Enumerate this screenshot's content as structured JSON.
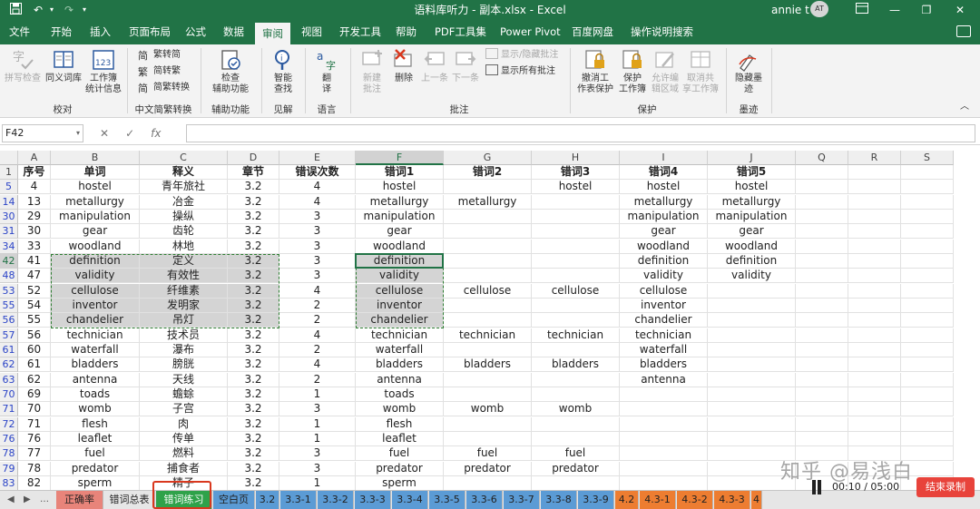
{
  "titlebar": {
    "title": "语料库听力 - 副本.xlsx  -  Excel",
    "user": "annie t",
    "avatar": "AT"
  },
  "ribbon_tabs": [
    "文件",
    "开始",
    "插入",
    "页面布局",
    "公式",
    "数据",
    "审阅",
    "视图",
    "开发工具",
    "帮助",
    "PDF工具集",
    "Power Pivot",
    "百度网盘"
  ],
  "active_tab": "审阅",
  "tell_me": "操作说明搜索",
  "ribbon": {
    "proof": {
      "spell": "拼写检查",
      "thesaurus": "同义词库",
      "stats_1": "工作簿",
      "stats_2": "统计信息",
      "group": "校对"
    },
    "chinese": {
      "to_trad": "繁转简",
      "to_simp": "简转繁",
      "convert": "简繁转换",
      "group": "中文简繁转换"
    },
    "access": {
      "check_1": "检查",
      "check_2": "辅助功能",
      "group": "辅助功能"
    },
    "insights": {
      "smart_1": "智能",
      "smart_2": "查找",
      "group": "见解"
    },
    "language": {
      "translate_1": "翻",
      "translate_2": "译",
      "group": "语言"
    },
    "comments": {
      "new_1": "新建",
      "new_2": "批注",
      "delete": "删除",
      "prev": "上一条",
      "next": "下一条",
      "show_hide": "显示/隐藏批注",
      "show_all": "显示所有批注",
      "group": "批注"
    },
    "protect": {
      "unprotect_1": "撤消工",
      "unprotect_2": "作表保护",
      "protect_wb_1": "保护",
      "protect_wb_2": "工作簿",
      "allow_1": "允许编",
      "allow_2": "辑区域",
      "unshare_1": "取消共",
      "unshare_2": "享工作簿",
      "group": "保护"
    },
    "ink": {
      "hide_1": "隐藏墨",
      "hide_2": "迹",
      "group": "墨迹"
    }
  },
  "formula_bar": {
    "name_box": "F42",
    "fx": "fx"
  },
  "columns": [
    "A",
    "B",
    "C",
    "D",
    "E",
    "F",
    "G",
    "H",
    "I",
    "J",
    "Q",
    "R",
    "S"
  ],
  "header_row": {
    "row_num": "1",
    "cells": [
      "序号",
      "单词",
      "释义",
      "章节",
      "错误次数",
      "错词1",
      "错词2",
      "错词3",
      "错词4",
      "错词5"
    ]
  },
  "rows": [
    {
      "n": "5",
      "cells": [
        "4",
        "hostel",
        "青年旅社",
        "3.2",
        "4",
        "hostel",
        "",
        "hostel",
        "hostel",
        "hostel"
      ]
    },
    {
      "n": "14",
      "cells": [
        "13",
        "metallurgy",
        "冶金",
        "3.2",
        "4",
        "metallurgy",
        "metallurgy",
        "",
        "metallurgy",
        "metallurgy"
      ]
    },
    {
      "n": "30",
      "cells": [
        "29",
        "manipulation",
        "操纵",
        "3.2",
        "3",
        "manipulation",
        "",
        "",
        "manipulation",
        "manipulation"
      ]
    },
    {
      "n": "31",
      "cells": [
        "30",
        "gear",
        "齿轮",
        "3.2",
        "3",
        "gear",
        "",
        "",
        "gear",
        "gear"
      ]
    },
    {
      "n": "34",
      "cells": [
        "33",
        "woodland",
        "林地",
        "3.2",
        "3",
        "woodland",
        "",
        "",
        "woodland",
        "woodland"
      ]
    },
    {
      "n": "42",
      "cells": [
        "41",
        "definition",
        "定义",
        "3.2",
        "3",
        "definition",
        "",
        "",
        "definition",
        "definition"
      ]
    },
    {
      "n": "48",
      "cells": [
        "47",
        "validity",
        "有效性",
        "3.2",
        "3",
        "validity",
        "",
        "",
        "validity",
        "validity"
      ]
    },
    {
      "n": "53",
      "cells": [
        "52",
        "cellulose",
        "纤维素",
        "3.2",
        "4",
        "cellulose",
        "cellulose",
        "cellulose",
        "cellulose",
        ""
      ]
    },
    {
      "n": "55",
      "cells": [
        "54",
        "inventor",
        "发明家",
        "3.2",
        "2",
        "inventor",
        "",
        "",
        "inventor",
        ""
      ]
    },
    {
      "n": "56",
      "cells": [
        "55",
        "chandelier",
        "吊灯",
        "3.2",
        "2",
        "chandelier",
        "",
        "",
        "chandelier",
        ""
      ]
    },
    {
      "n": "57",
      "cells": [
        "56",
        "technician",
        "技术员",
        "3.2",
        "4",
        "technician",
        "technician",
        "technician",
        "technician",
        ""
      ]
    },
    {
      "n": "61",
      "cells": [
        "60",
        "waterfall",
        "瀑布",
        "3.2",
        "2",
        "waterfall",
        "",
        "",
        "waterfall",
        ""
      ]
    },
    {
      "n": "62",
      "cells": [
        "61",
        "bladders",
        "膀胱",
        "3.2",
        "4",
        "bladders",
        "bladders",
        "bladders",
        "bladders",
        ""
      ]
    },
    {
      "n": "63",
      "cells": [
        "62",
        "antenna",
        "天线",
        "3.2",
        "2",
        "antenna",
        "",
        "",
        "antenna",
        ""
      ]
    },
    {
      "n": "70",
      "cells": [
        "69",
        "toads",
        "蟾蜍",
        "3.2",
        "1",
        "toads",
        "",
        "",
        "",
        ""
      ]
    },
    {
      "n": "71",
      "cells": [
        "70",
        "womb",
        "子宫",
        "3.2",
        "3",
        "womb",
        "womb",
        "womb",
        "",
        ""
      ]
    },
    {
      "n": "72",
      "cells": [
        "71",
        "flesh",
        "肉",
        "3.2",
        "1",
        "flesh",
        "",
        "",
        "",
        ""
      ]
    },
    {
      "n": "76",
      "cells": [
        "76",
        "leaflet",
        "传单",
        "3.2",
        "1",
        "leaflet",
        "",
        "",
        "",
        ""
      ]
    },
    {
      "n": "78",
      "cells": [
        "77",
        "fuel",
        "燃料",
        "3.2",
        "3",
        "fuel",
        "fuel",
        "fuel",
        "",
        ""
      ]
    },
    {
      "n": "79",
      "cells": [
        "78",
        "predator",
        "捕食者",
        "3.2",
        "3",
        "predator",
        "predator",
        "predator",
        "",
        ""
      ]
    },
    {
      "n": "83",
      "cells": [
        "82",
        "sperm",
        "精子",
        "3.2",
        "1",
        "sperm",
        "",
        "",
        "",
        ""
      ]
    }
  ],
  "sheet_tabs": [
    {
      "label": "正确率",
      "color": "#e8847a"
    },
    {
      "label": "错词总表",
      "color": "#e6e6e6"
    },
    {
      "label": "错词练习",
      "color": "#2fa24a"
    },
    {
      "label": "空白页",
      "color": "#5b9bd5"
    },
    {
      "label": "3.2",
      "color": "#5b9bd5"
    },
    {
      "label": "3.3-1",
      "color": "#5b9bd5"
    },
    {
      "label": "3.3-2",
      "color": "#5b9bd5"
    },
    {
      "label": "3.3-3",
      "color": "#5b9bd5"
    },
    {
      "label": "3.3-4",
      "color": "#5b9bd5"
    },
    {
      "label": "3.3-5",
      "color": "#5b9bd5"
    },
    {
      "label": "3.3-6",
      "color": "#5b9bd5"
    },
    {
      "label": "3.3-7",
      "color": "#5b9bd5"
    },
    {
      "label": "3.3-8",
      "color": "#5b9bd5"
    },
    {
      "label": "3.3-9",
      "color": "#5b9bd5"
    },
    {
      "label": "4.2",
      "color": "#ed7d31"
    },
    {
      "label": "4.3-1",
      "color": "#ed7d31"
    },
    {
      "label": "4.3-2",
      "color": "#ed7d31"
    },
    {
      "label": "4.3-3",
      "color": "#ed7d31"
    },
    {
      "label": "4",
      "color": "#ed7d31"
    }
  ],
  "watermark": "知乎 @易浅白",
  "recorder": {
    "time": "00:10 / 05:00",
    "stop": "结束录制"
  },
  "colors": {
    "excel_green": "#217346",
    "selection_grey": "#d4d4d4",
    "marquee": "#2e7d32"
  }
}
